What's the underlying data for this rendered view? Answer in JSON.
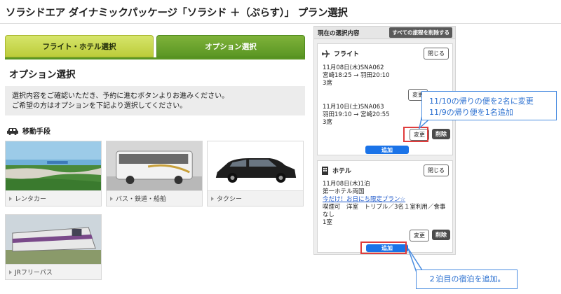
{
  "page": {
    "title": "ソラシドエア ダイナミックパッケージ「ソラシド ＋（ぷらす）」 プラン選択"
  },
  "tabs": [
    {
      "label": "フライト・ホテル選択"
    },
    {
      "label": "オプション選択",
      "active": true
    }
  ],
  "main": {
    "section_title": "オプション選択",
    "info_lines": [
      "選択内容をご確認いただき、予約に進むボタンよりお進みください。",
      "ご希望の方はオプションを下記より選択してください。"
    ],
    "group_title": "移動手段",
    "group_icon": "car-icon",
    "options": [
      {
        "label": "レンタカー",
        "image": "coastal-road-photo"
      },
      {
        "label": "バス・鉄道・船舶",
        "image": "bus-photo"
      },
      {
        "label": "タクシー",
        "image": "taxi-photo"
      },
      {
        "label": "JRフリーパス",
        "image": "train-photo"
      }
    ]
  },
  "sidebar": {
    "title": "現在の選択内容",
    "clear_all_label": "すべての旅程を削除する",
    "flight": {
      "icon": "airplane-icon",
      "label": "フライト",
      "close_label": "閉じる",
      "segments": [
        {
          "lines": [
            "11月08日(木)SNA062",
            "宮崎18:25 → 羽田20:10",
            "3席"
          ],
          "change_label": "変更"
        },
        {
          "lines": [
            "11月10日(土)SNA063",
            "羽田19:10 → 宮崎20:55",
            "3席"
          ],
          "change_label": "変更",
          "delete_label": "削除"
        }
      ],
      "add_label": "追加"
    },
    "hotel": {
      "icon": "building-icon",
      "label": "ホテル",
      "close_label": "閉じる",
      "lines": [
        "11月08日(木)1泊",
        "第一ホテル両国"
      ],
      "link": "今だけ！お日にち限定プラン☆",
      "detail_lines": [
        "喫煙可　洋室　トリプル／3名１室利用／食事",
        "なし",
        "1室"
      ],
      "change_label": "変更",
      "delete_label": "削除",
      "add_label": "追加"
    }
  },
  "callouts": {
    "flight_note": [
      "11/10の帰りの便を2名に変更",
      "11/9の帰り便を1名追加"
    ],
    "hotel_note": "２泊目の宿泊を追加。"
  },
  "colors": {
    "tab_inactive": "#c8d74a",
    "tab_active": "#5a9623",
    "blue_button": "#1a73e8",
    "highlight": "#e03c3c",
    "callout": "#4a8de0"
  }
}
